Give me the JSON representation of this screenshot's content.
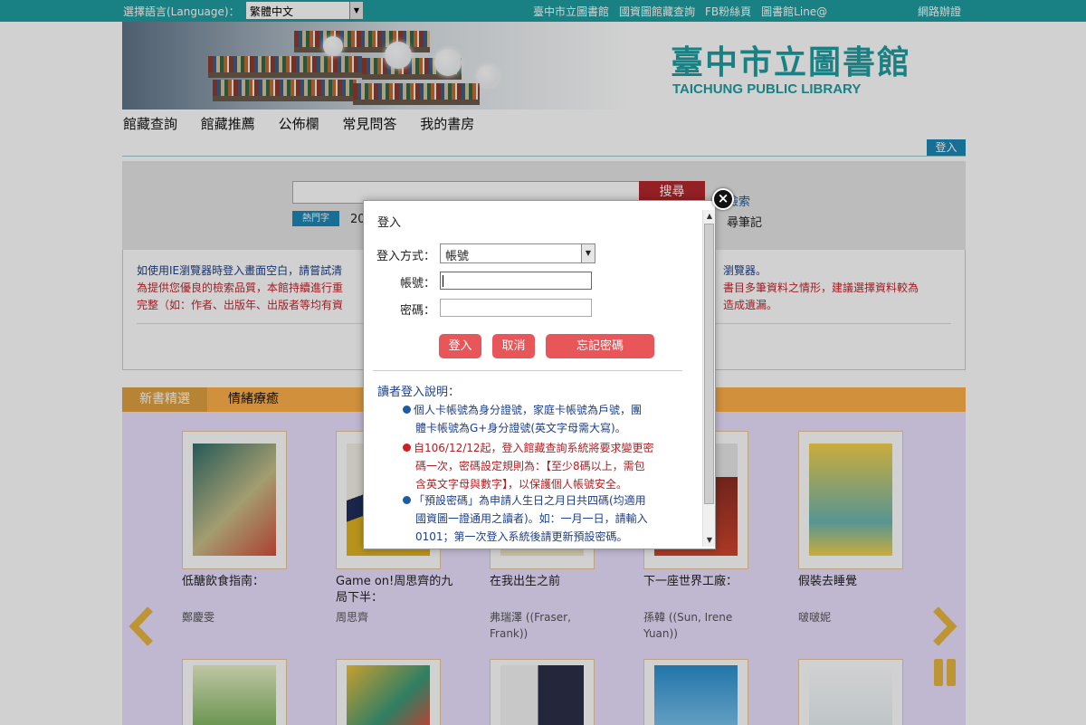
{
  "topbar": {
    "lang_label": "選擇語言(Language)：",
    "lang_value": "繁體中文",
    "links": [
      "臺中市立圖書館",
      "國資圖館藏查詢",
      "FB粉絲頁",
      "圖書館Line@"
    ],
    "sitemap": "網路辦證"
  },
  "banner": {
    "logo_zh": "臺中市立圖書館",
    "logo_en": "TAICHUNG PUBLIC LIBRARY"
  },
  "nav": {
    "items": [
      "館藏查詢",
      "館藏推薦",
      "公佈欄",
      "常見問答",
      "我的書房"
    ],
    "login": "登入"
  },
  "search": {
    "button": "搜尋",
    "advanced_partial": "檢索",
    "hot_tag": "熱門字",
    "hot_partial": "20",
    "notes_partial": "尋筆記"
  },
  "notice": {
    "line1_left": "如使用IE瀏覽器時登入畫面空白，請嘗試清",
    "line1_right": "瀏覽器。",
    "line2_left": "為提供您優良的檢索品質，本館持續進行重",
    "line2_right": "書目多筆資料之情形，建議選擇資料較為",
    "line3_left": "完整（如：作者、出版年、出版者等均有資",
    "line3_right": "造成遺漏。"
  },
  "books": {
    "tab_active": "新書精選",
    "tab_other": "情緒療癒",
    "items": [
      {
        "title": "低醣飲食指南：",
        "author": "鄭慶雯"
      },
      {
        "title": "Game on!周思齊的九局下半：",
        "author": "周思齊"
      },
      {
        "title": "在我出生之前",
        "author": "弗瑞澤 ((Fraser, Frank))"
      },
      {
        "title": "下一座世界工廠：",
        "author": "孫韓 ((Sun, Irene Yuan))"
      },
      {
        "title": "假裝去睡覺",
        "author": "啵啵妮"
      }
    ]
  },
  "modal": {
    "title": "登入",
    "method_label": "登入方式：",
    "method_value": "帳號",
    "account_label": "帳號：",
    "password_label": "密碼：",
    "btn_login": "登入",
    "btn_cancel": "取消",
    "btn_forgot": "忘記密碼",
    "help_title": "讀者登入說明：",
    "help_items": [
      {
        "color": "blue",
        "line1": "個人卡帳號為身分證號，家庭卡帳號為戶號，團",
        "line2": "體卡帳號為G+身分證號(英文字母需大寫)。"
      },
      {
        "color": "red",
        "line1": "自106/12/12起，登入館藏查詢系統將要求變更密",
        "line2": "碼一次，密碼設定規則為：【至少8碼以上，需包",
        "line3": "含英文字母與數字】，以保護個人帳號安全。"
      },
      {
        "color": "blue",
        "line1": "「預設密碼」為申請人生日之月日共四碼(均適用",
        "line2": "國資圖一證通用之讀者)。如：一月一日，請輸入",
        "line3": "0101；第一次登入系統後請更新預設密碼。"
      }
    ]
  },
  "colors": {
    "teal": "#1f9ea0",
    "login_blue": "#1e88b8",
    "search_red": "#b3282d",
    "button_red": "#e8565a",
    "tab_orange": "#ffb04a",
    "books_bg": "#ebe0ff"
  }
}
